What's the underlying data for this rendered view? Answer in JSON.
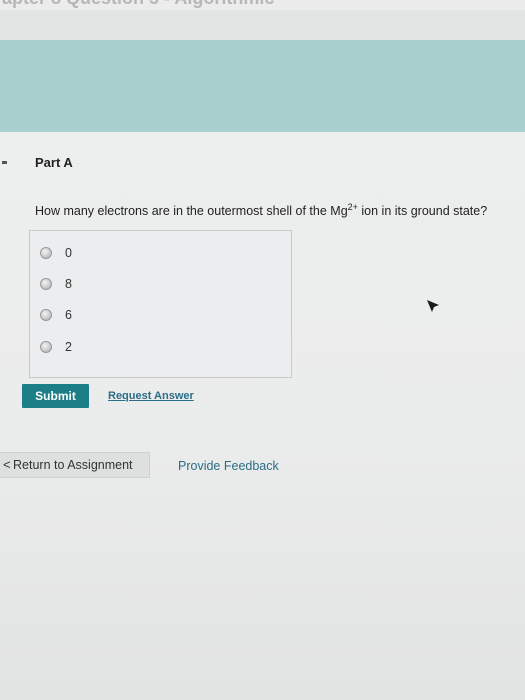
{
  "header": {
    "title_fragment": "apter 8 Question 5 - Algorithmic"
  },
  "part": {
    "title": "Part A"
  },
  "question": {
    "text_before": "How many electrons are in the outermost shell of the Mg",
    "superscript": "2+",
    "text_after": " ion in its ground state?"
  },
  "choices": [
    {
      "label": "0"
    },
    {
      "label": "8"
    },
    {
      "label": "6"
    },
    {
      "label": "2"
    }
  ],
  "actions": {
    "submit_label": "Submit",
    "request_answer_label": "Request Answer"
  },
  "footer": {
    "return_chevron": "<",
    "return_label": "Return to Assignment",
    "feedback_label": "Provide Feedback"
  },
  "colors": {
    "banner": "#a7d0cf",
    "submit_button": "#1c7e86",
    "link": "#2a6d86"
  }
}
